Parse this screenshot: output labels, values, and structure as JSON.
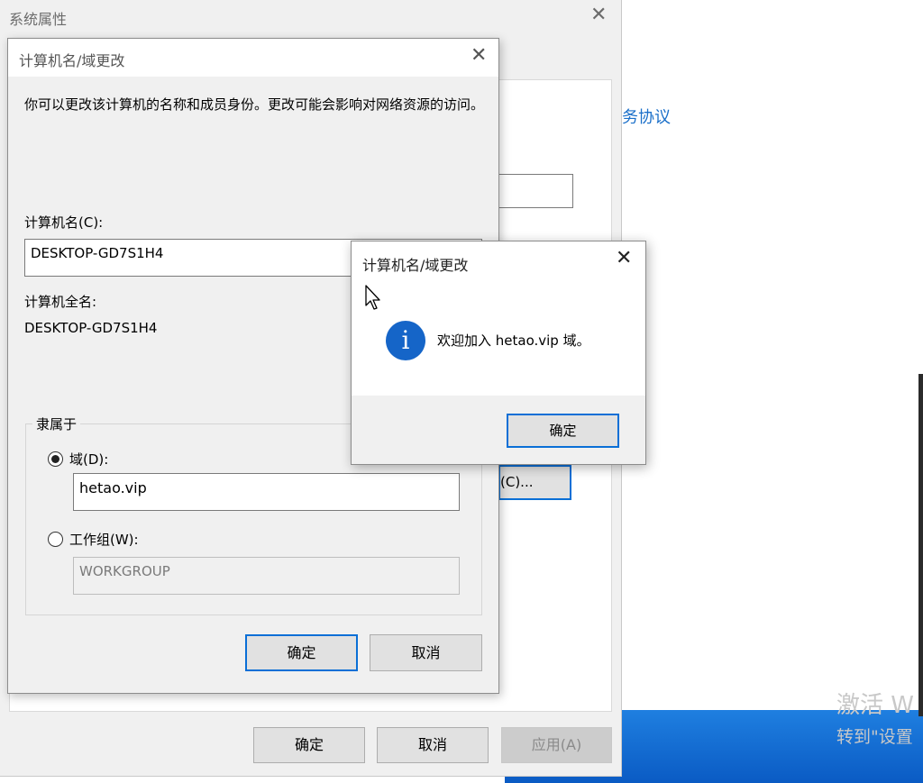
{
  "desktop": {
    "activate_title": "激活 W",
    "activate_hint": "转到\"设置"
  },
  "system_properties": {
    "title": "系统属性",
    "close_glyph": "✕",
    "link_fragment": "务协议",
    "change_button_fragment": "(C)...",
    "ok_label": "确定",
    "cancel_label": "取消",
    "apply_label": "应用(A)"
  },
  "computer_name_dialog": {
    "title": "计算机名/域更改",
    "close_glyph": "✕",
    "description": "你可以更改该计算机的名称和成员身份。更改可能会影响对网络资源的访问。",
    "computer_name_label": "计算机名(C):",
    "computer_name_value": "DESKTOP-GD7S1H4",
    "full_name_label": "计算机全名:",
    "full_name_value": "DESKTOP-GD7S1H4",
    "member_of_label": "隶属于",
    "domain_label": "域(D):",
    "domain_value": "hetao.vip",
    "workgroup_label": "工作组(W):",
    "workgroup_value": "WORKGROUP",
    "ok_label": "确定",
    "cancel_label": "取消"
  },
  "message_box": {
    "title": "计算机名/域更改",
    "close_glyph": "✕",
    "icon_glyph": "i",
    "message": "欢迎加入 hetao.vip 域。",
    "ok_label": "确定"
  },
  "colors": {
    "accent": "#0a6fd6",
    "info_icon": "#1565c8",
    "link": "#1a6fc9"
  }
}
